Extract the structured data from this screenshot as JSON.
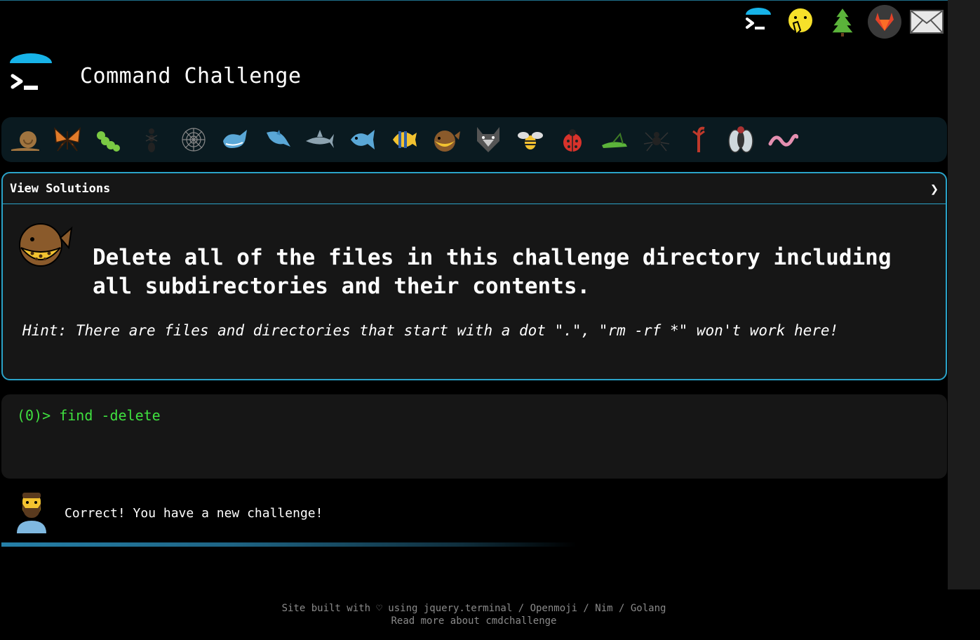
{
  "header": {
    "title": "Command Challenge",
    "logo_icon": "terminal-logo-icon"
  },
  "top_nav": {
    "icons": [
      "terminal-icon",
      "face-with-hand-over-mouth-icon",
      "evergreen-tree-icon",
      "gitlab-icon",
      "envelope-icon"
    ]
  },
  "animals": [
    "snail-icon",
    "butterfly-icon",
    "caterpillar-icon",
    "ant-icon",
    "spider-web-icon",
    "whale-icon",
    "dolphin-icon",
    "shark-icon",
    "fish-icon",
    "tropical-fish-icon",
    "blowfish-icon",
    "wolf-icon",
    "bee-icon",
    "ladybug-icon",
    "cricket-icon",
    "spider-icon",
    "scorpion-icon",
    "fly-icon",
    "worm-icon"
  ],
  "panel": {
    "view_solutions_label": "View Solutions",
    "chevron": "❯",
    "challenge_icon": "blowfish-icon",
    "challenge_text": "Delete all of the files in this challenge directory including all subdirectories and their contents.",
    "hint": "Hint: There are files and directories that start with a dot \".\", \"rm -rf *\" won't work here!"
  },
  "terminal": {
    "prompt": "(0)> ",
    "command": "find -delete"
  },
  "result": {
    "avatar": "person-beard-avatar",
    "message": "Correct! You have a new challenge!"
  },
  "progress": {
    "fraction": 0.59
  },
  "footer": {
    "line1": "Site built with ♡ using jquery.terminal / Openmoji / Nim / Golang",
    "line2": "Read more about cmdchallenge"
  },
  "colors": {
    "accent": "#2aa3c9",
    "terminal_text": "#3fe03f",
    "panel_bg": "#161616"
  }
}
